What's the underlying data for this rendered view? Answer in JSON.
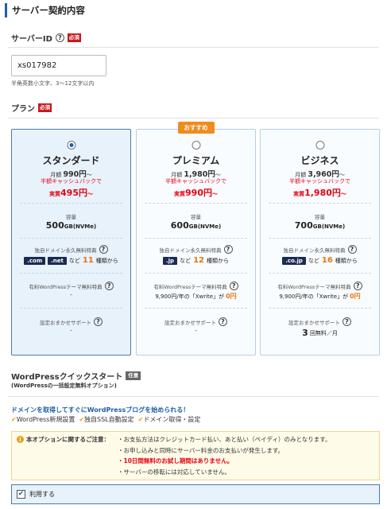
{
  "section_title": "サーバー契約内容",
  "server_id": {
    "label": "サーバーID",
    "required": "必須",
    "value": "xs017982",
    "hint": "半角英数小文字、3～12文字以内"
  },
  "plan": {
    "label": "プラン",
    "required": "必須",
    "recommended_badge": "おすすめ",
    "storage_label": "容量",
    "domain_label": "独自ドメイン永久無料特典",
    "theme_label": "有料WordPressテーマ無料特典",
    "support_label": "設定おまかせサポート",
    "help_glyph": "?",
    "cards": [
      {
        "name": "スタンダード",
        "price_prefix": "月額",
        "price": "990円",
        "price_suffix": "～",
        "cashback": "半額キャッシュバックで",
        "real_prefix": "実質",
        "real_price": "495円",
        "real_suffix": "～",
        "storage_num": "500",
        "storage_unit": "GB(NVMe)",
        "domains": [
          ".com",
          ".net"
        ],
        "domain_mid": "など",
        "domain_count": "11",
        "domain_suffix": "種類から",
        "theme": "-",
        "support": "-",
        "selected": true
      },
      {
        "name": "プレミアム",
        "price_prefix": "月額",
        "price": "1,980円",
        "price_suffix": "～",
        "cashback": "半額キャッシュバックで",
        "real_prefix": "実質",
        "real_price": "990円",
        "real_suffix": "～",
        "storage_num": "600",
        "storage_unit": "GB(NVMe)",
        "domains": [
          ".jp"
        ],
        "domain_mid": "など",
        "domain_count": "12",
        "domain_suffix": "種類から",
        "theme_pre": "9,900円/年の「Xwrite」が",
        "theme_free": "0円",
        "support": "-",
        "selected": false
      },
      {
        "name": "ビジネス",
        "price_prefix": "月額",
        "price": "3,960円",
        "price_suffix": "～",
        "cashback": "半額キャッシュバックで",
        "real_prefix": "実質",
        "real_price": "1,980円",
        "real_suffix": "～",
        "storage_num": "700",
        "storage_unit": "GB(NVMe)",
        "domains": [
          ".co.jp"
        ],
        "domain_mid": "など",
        "domain_count": "16",
        "domain_suffix": "種類から",
        "theme_pre": "9,900円/年の「Xwrite」が",
        "theme_free": "0円",
        "support_num": "3",
        "support_unit": "回無料／月",
        "selected": false
      }
    ]
  },
  "quick_start": {
    "label": "WordPressクイックスタート",
    "optional": "任意",
    "desc": "(WordPressの一括設定無料オプション)",
    "lead_pre": "ドメインを取得してすぐに",
    "lead_bold": "WordPress",
    "lead_post": "ブログを始められる！",
    "features": [
      "WordPress新規設置",
      "独自SSL自動設定",
      "ドメイン取得・設定"
    ],
    "check_glyph": "✔",
    "notice_title": "本オプションに関するご注意：",
    "notice_items": [
      "お支払方法はクレジットカード払い、あと払い（ペイディ）のみとなります。",
      "お申し込みと同時にサーバー料金のお支払いが発生します。",
      "10日間無料のお試し期間はありません。",
      "サーバーの移転には対応していません。"
    ],
    "use_label": "利用する",
    "use_checked": true
  }
}
